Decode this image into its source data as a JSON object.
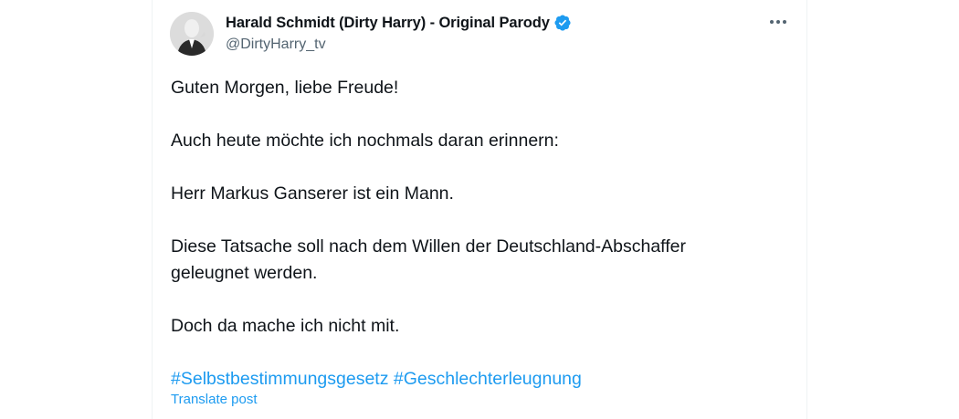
{
  "tweet": {
    "author": {
      "display_name": "Harald Schmidt (Dirty Harry) - Original Parody",
      "handle": "@DirtyHarry_tv",
      "verified": true,
      "avatar_icon": "avatar-photo"
    },
    "more_icon": "more-horizontal-icon",
    "paragraphs": [
      "Guten Morgen, liebe Freude!",
      "Auch heute möchte ich nochmals daran erinnern:",
      "Herr Markus Ganserer ist ein Mann.",
      "Diese Tatsache soll nach dem Willen der Deutschland-Abschaffer",
      "geleugnet werden.",
      "Doch da mache ich nicht mit."
    ],
    "hashtags": [
      "#Selbstbestimmungsgesetz",
      "#Geschlechterleugnung"
    ],
    "translate_label": "Translate post",
    "colors": {
      "text": "#0f1419",
      "secondary": "#536471",
      "link": "#1d9bf0"
    }
  }
}
